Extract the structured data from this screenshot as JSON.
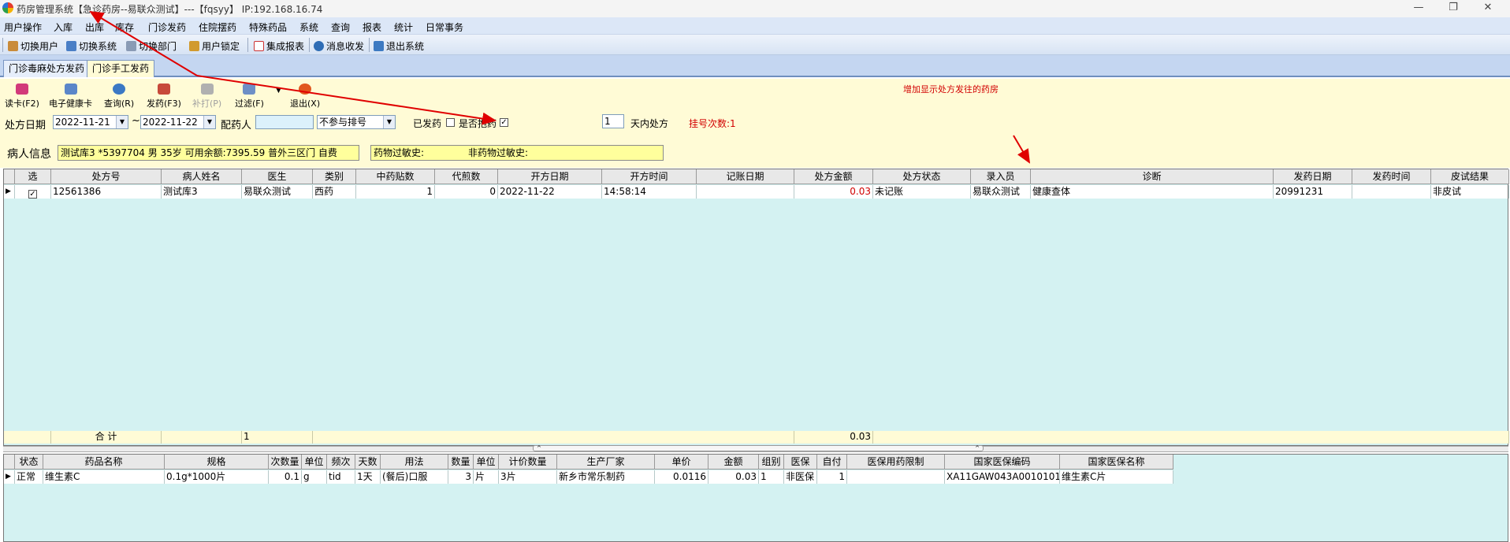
{
  "window": {
    "title": "药房管理系统【急诊药房--易联众测试】---【fqsyy】 IP:192.168.16.74",
    "minimize": "—",
    "maximize": "❐",
    "close": "✕"
  },
  "menu": [
    "用户操作",
    "入库",
    "出库",
    "库存",
    "门诊发药",
    "住院摆药",
    "特殊药品",
    "系统",
    "查询",
    "报表",
    "统计",
    "日常事务"
  ],
  "toolbar": [
    "切换用户",
    "切换系统",
    "切换部门",
    "用户锁定",
    "集成报表",
    "消息收发",
    "退出系统"
  ],
  "tabs": [
    "门诊毒麻处方发药",
    "门诊手工发药"
  ],
  "actions": [
    "读卡(F2)",
    "电子健康卡",
    "查询(R)",
    "发药(F3)",
    "补打(P)",
    "过滤(F)",
    "退出(X)"
  ],
  "filter": {
    "date_label": "处方日期",
    "date_from": "2022-11-21",
    "tilde": "~",
    "date_to": "2022-11-22",
    "pharmacist_label": "配药人",
    "queue_option": "不参与排号",
    "dispensed_label": "已发药",
    "exclude_label": "是否抱药",
    "days_value": "1",
    "days_label": "天内处方",
    "reg_count": "挂号次数:1"
  },
  "annotation": "增加显示处方发往的药房",
  "patient": {
    "label": "病人信息",
    "info": "测试库3 *5397704 男 35岁 可用余额:7395.59 普外三区门 自费",
    "allergy": "药物过敏史:",
    "non_drug_allergy": "非药物过敏史:"
  },
  "grid1": {
    "headers": [
      "选",
      "处方号",
      "病人姓名",
      "医生",
      "类别",
      "中药贴数",
      "代煎数",
      "开方日期",
      "开方时间",
      "记账日期",
      "处方金额",
      "处方状态",
      "录入员",
      "诊断",
      "发药日期",
      "发药时间",
      "皮试结果"
    ],
    "row": {
      "check": "✓",
      "rx_no": "12561386",
      "name": "测试库3",
      "doctor": "易联众测试",
      "category": "西药",
      "herbal_count": "1",
      "decoct": "0",
      "rx_date": "2022-11-22",
      "rx_time": "14:58:14",
      "bill_date": "",
      "amount": "0.03",
      "status": "未记账",
      "clerk": "易联众测试",
      "diagnosis": "健康查体",
      "dispense_date": "20991231",
      "dispense_time": "",
      "skin_test": "非皮试"
    },
    "summary": {
      "label": "合    计",
      "count": "1",
      "amount": "0.03"
    }
  },
  "grid2": {
    "headers": [
      "状态",
      "药品名称",
      "规格",
      "次数量",
      "单位",
      "频次",
      "天数",
      "用法",
      "数量",
      "单位",
      "计价数量",
      "生产厂家",
      "单价",
      "金额",
      "组别",
      "医保",
      "自付",
      "医保用药限制",
      "国家医保编码",
      "国家医保名称"
    ],
    "row": {
      "status": "正常",
      "drug": "维生素C",
      "spec": "0.1g*1000片",
      "dose": "0.1",
      "unit": "g",
      "freq": "tid",
      "days": "1天",
      "usage": "(餐后)口服",
      "qty": "3",
      "qty_unit": "片",
      "bill_qty": "3片",
      "maker": "新乡市常乐制药",
      "price": "0.0116",
      "amount": "0.03",
      "group": "1",
      "insurance": "非医保",
      "self_pay": "1",
      "limit": "",
      "code": "XA11GAW043A001010104",
      "name": "维生素C片"
    }
  },
  "colors": {
    "menubar": "#dce7f7",
    "panel": "#fffbd6",
    "grid": "#d4f2f2",
    "arrow": "#e00000"
  }
}
